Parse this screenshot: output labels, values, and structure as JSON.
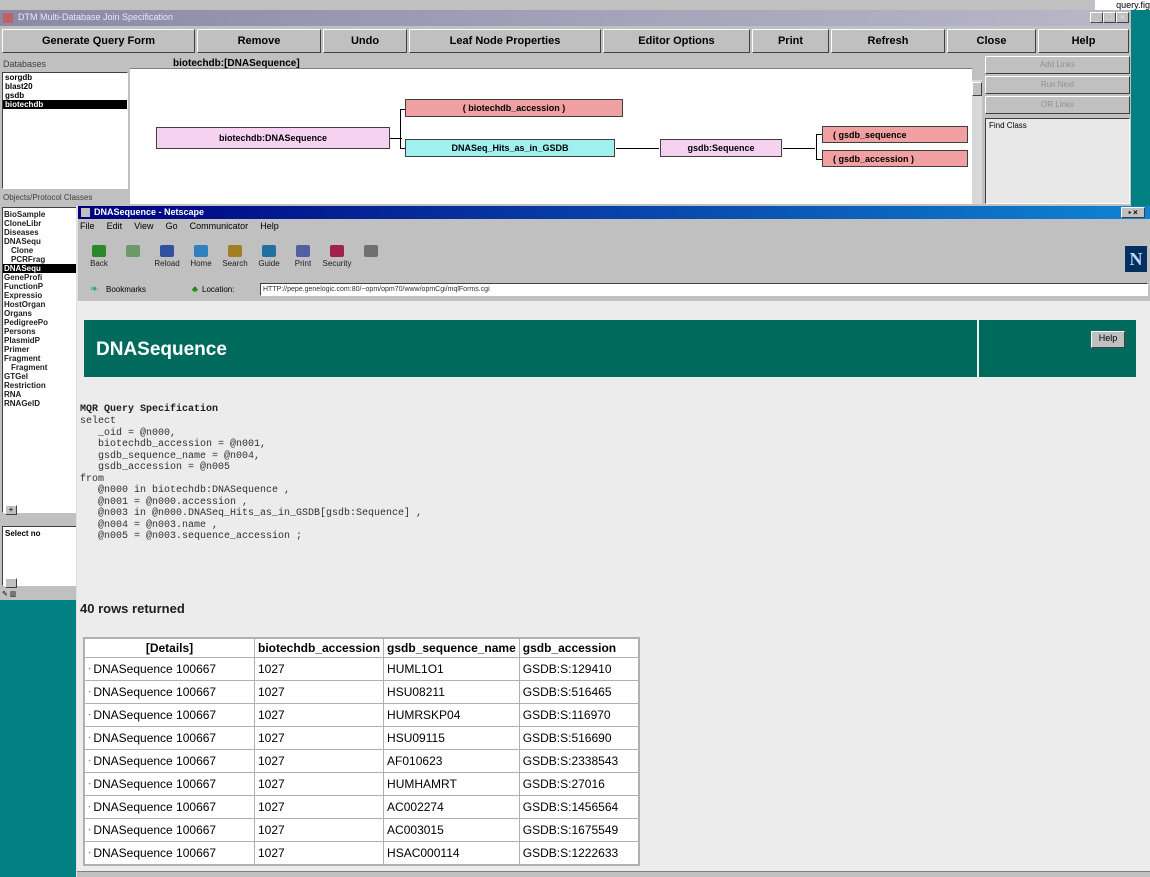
{
  "outer": {
    "title": "DTM Multi-Database Join Specification",
    "toolbar": [
      "Generate Query Form",
      "Remove",
      "Undo",
      "Leaf Node Properties",
      "Editor Options",
      "Print",
      "Refresh",
      "Close",
      "Help"
    ],
    "db_label": "Databases",
    "breadcrumb": "biotechdb:[DNASequence]",
    "databases": [
      "sorgdb",
      "blast20",
      "gsdb",
      "biotechdb"
    ],
    "selected_db": "biotechdb",
    "right_buttons": [
      "Add Links",
      "Run Next",
      "OR Links"
    ],
    "right_label": "Find Class",
    "classes_label": "Objects/Protocol Classes",
    "classes": [
      "BioSample",
      "CloneLibr",
      "Diseases",
      "DNASequ",
      "Clone",
      "PCRFrag",
      "DNASequ",
      "GeneProfi",
      "FunctionP",
      "Expressio",
      "HostOrgan",
      "Organs",
      "PedigreePo",
      "Persons",
      "PlasmidP",
      "Primer",
      "Fragment",
      "Fragment",
      "GTGel",
      "Restriction",
      "RNA",
      "RNAGelD"
    ],
    "selected_class_index": 6,
    "select_label": "Select no",
    "nodes": {
      "root": "biotechdb:DNASequence",
      "accession": "( biotechdb_accession )",
      "hits": "DNASeq_Hits_as_in_GSDB",
      "gsdb": "gsdb:Sequence",
      "gsdb_seq": "( gsdb_sequence",
      "gsdb_acc": "( gsdb_accession )"
    },
    "page_corner": "query.fig"
  },
  "netscape": {
    "title": "DNASequence - Netscape",
    "menu": [
      "File",
      "Edit",
      "View",
      "Go",
      "Communicator",
      "Help"
    ],
    "nav": [
      {
        "label": "Back",
        "icon": "back-icon"
      },
      {
        "label": "Forward",
        "icon": "forward-icon"
      },
      {
        "label": "Reload",
        "icon": "reload-icon"
      },
      {
        "label": "Home",
        "icon": "home-icon"
      },
      {
        "label": "Search",
        "icon": "search-icon"
      },
      {
        "label": "Guide",
        "icon": "guide-icon"
      },
      {
        "label": "Print",
        "icon": "print-icon"
      },
      {
        "label": "Security",
        "icon": "security-icon"
      },
      {
        "label": "Stop",
        "icon": "stop-icon"
      }
    ],
    "bookmarks_label": "Bookmarks",
    "location_label": "Location:",
    "url": "HTTP://pepe.genelogic.com:80/~opm/opm70/www/opmCgi/mqlForms.cgi",
    "page": {
      "heading": "DNASequence",
      "help": "Help",
      "mql_title": "MQR Query Specification",
      "mql_lines": [
        "select",
        "   _oid = @n000,",
        "   biotechdb_accession = @n001,",
        "   gsdb_sequence_name = @n004,",
        "   gsdb_accession = @n005",
        "from",
        "   @n000 in biotechdb:DNASequence ,",
        "   @n001 = @n000.accession ,",
        "   @n003 in @n000.DNASeq_Hits_as_in_GSDB[gsdb:Sequence] ,",
        "   @n004 = @n003.name ,",
        "   @n005 = @n003.sequence_accession ;"
      ],
      "rows_returned": "40 rows returned",
      "columns": [
        "[Details]",
        "biotechdb_accession",
        "gsdb_sequence_name",
        "gsdb_accession"
      ],
      "rows": [
        [
          "DNASequence 100667",
          "1027",
          "HUML1O1",
          "GSDB:S:129410"
        ],
        [
          "DNASequence 100667",
          "1027",
          "HSU08211",
          "GSDB:S:516465"
        ],
        [
          "DNASequence 100667",
          "1027",
          "HUMRSKP04",
          "GSDB:S:116970"
        ],
        [
          "DNASequence 100667",
          "1027",
          "HSU09115",
          "GSDB:S:516690"
        ],
        [
          "DNASequence 100667",
          "1027",
          "AF010623",
          "GSDB:S:2338543"
        ],
        [
          "DNASequence 100667",
          "1027",
          "HUMHAMRT",
          "GSDB:S:27016"
        ],
        [
          "DNASequence 100667",
          "1027",
          "AC002274",
          "GSDB:S:1456564"
        ],
        [
          "DNASequence 100667",
          "1027",
          "AC003015",
          "GSDB:S:1675549"
        ],
        [
          "DNASequence 100667",
          "1027",
          "HSAC000114",
          "GSDB:S:1222633"
        ]
      ]
    }
  },
  "colors": {
    "desktop": "#008080",
    "banner": "#006a5c",
    "node_pink": "#f0a0a0",
    "node_lilac": "#f4d2f0",
    "node_cyan": "#a0f0f0"
  }
}
